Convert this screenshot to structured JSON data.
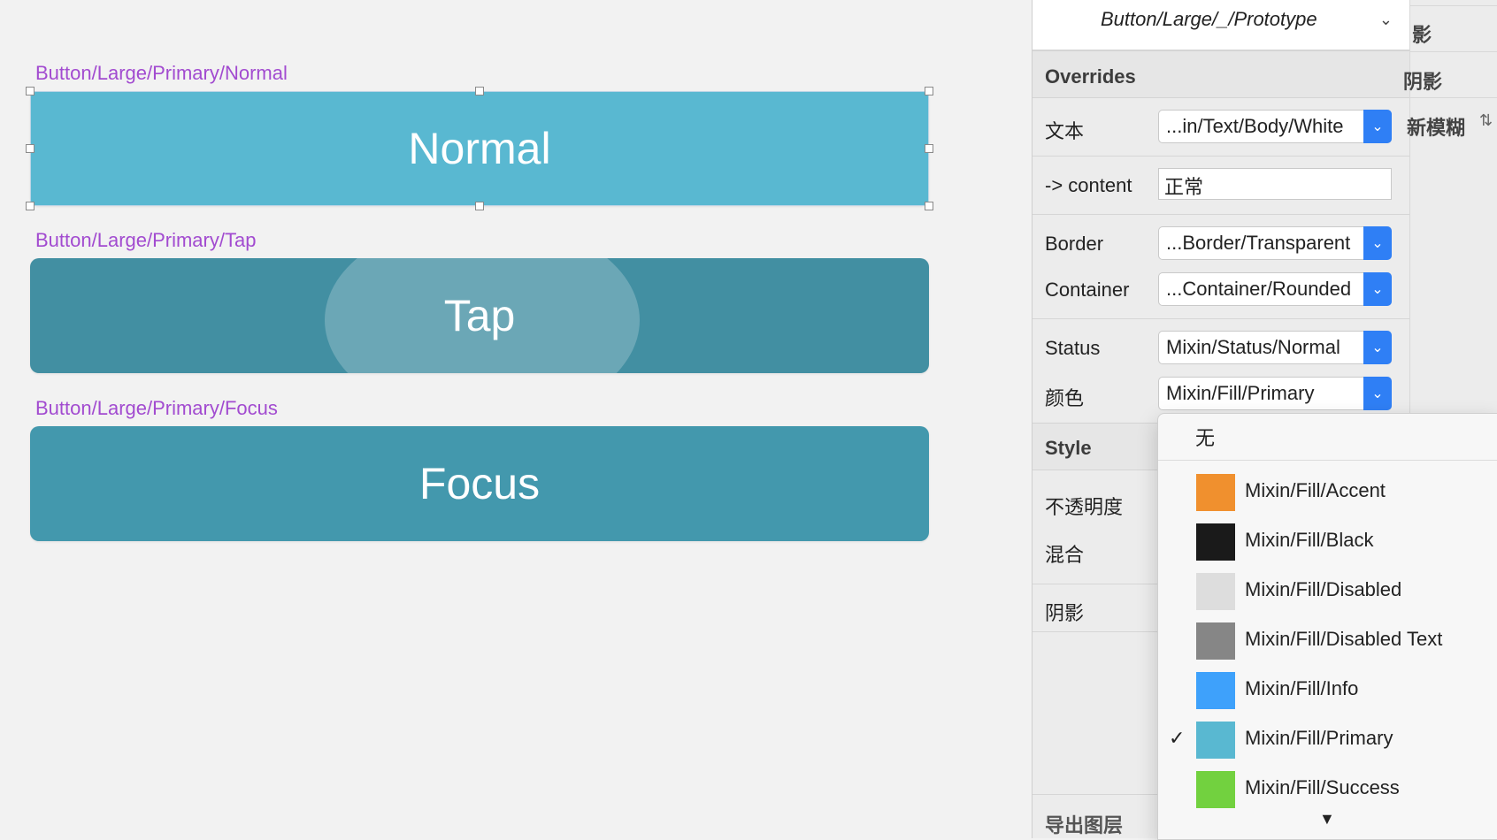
{
  "canvas": {
    "samples": [
      {
        "label": "Button/Large/Primary/Normal",
        "text": "Normal"
      },
      {
        "label": "Button/Large/Primary/Tap",
        "text": "Tap"
      },
      {
        "label": "Button/Large/Primary/Focus",
        "text": "Focus"
      }
    ]
  },
  "inspector": {
    "symbol_name": "Button/Large/_/Prototype",
    "overrides_title": "Overrides",
    "rows": {
      "text_label": "文本",
      "text_value": "...in/Text/Body/White",
      "content_label": "-> content",
      "content_value": "正常",
      "border_label": "Border",
      "border_value": "...Border/Transparent",
      "container_label": "Container",
      "container_value": "...Container/Rounded",
      "status_label": "Status",
      "status_value": "Mixin/Status/Normal",
      "color_label": "颜色",
      "color_value": "Mixin/Fill/Primary"
    },
    "style_title": "Style",
    "opacity_label": "不透明度",
    "blend_label": "混合",
    "shadow_label": "阴影",
    "export_label": "导出图层"
  },
  "sliver": {
    "items": [
      "影",
      "阴影",
      "新模糊"
    ]
  },
  "dropdown": {
    "none_label": "无",
    "items": [
      {
        "label": "Mixin/Fill/Accent",
        "color": "#f0902e",
        "checked": false
      },
      {
        "label": "Mixin/Fill/Black",
        "color": "#1a1a1a",
        "checked": false
      },
      {
        "label": "Mixin/Fill/Disabled",
        "color": "#dddddd",
        "checked": false
      },
      {
        "label": "Mixin/Fill/Disabled Text",
        "color": "#868686",
        "checked": false
      },
      {
        "label": "Mixin/Fill/Info",
        "color": "#3ea1fb",
        "checked": false
      },
      {
        "label": "Mixin/Fill/Primary",
        "color": "#59b8d1",
        "checked": true
      },
      {
        "label": "Mixin/Fill/Success",
        "color": "#72d13f",
        "checked": false
      }
    ]
  }
}
